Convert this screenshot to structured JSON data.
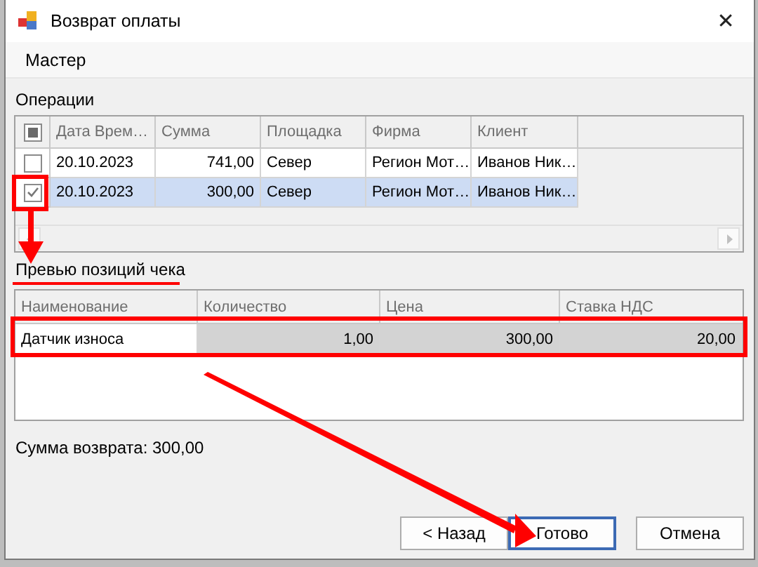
{
  "window": {
    "title": "Возврат оплаты",
    "close": "✕"
  },
  "wizard": {
    "title": "Мастер"
  },
  "operations": {
    "label": "Операции",
    "all_checked": false,
    "partly_checked": true,
    "columns": [
      "Дата Врем…",
      "Сумма",
      "Площадка",
      "Фирма",
      "Клиент"
    ],
    "rows": [
      {
        "checked": false,
        "selected": false,
        "cells": [
          "20.10.2023",
          "741,00",
          "Север",
          "Регион Мот…",
          "Иванов Ник…"
        ]
      },
      {
        "checked": true,
        "selected": true,
        "cells": [
          "20.10.2023",
          "300,00",
          "Север",
          "Регион Мот…",
          "Иванов Ник…"
        ]
      }
    ]
  },
  "preview": {
    "label": "Превью позиций чека",
    "columns": [
      "Наименование",
      "Количество",
      "Цена",
      "Ставка НДС"
    ],
    "rows": [
      {
        "selected": true,
        "cells": [
          "Датчик износа",
          "1,00",
          "300,00",
          "20,00"
        ]
      }
    ]
  },
  "total": "Сумма возврата: 300,00",
  "buttons": [
    {
      "label": "< Назад",
      "default": false
    },
    {
      "label": "Готово",
      "default": true
    },
    {
      "label": "Отмена",
      "default": false
    }
  ]
}
